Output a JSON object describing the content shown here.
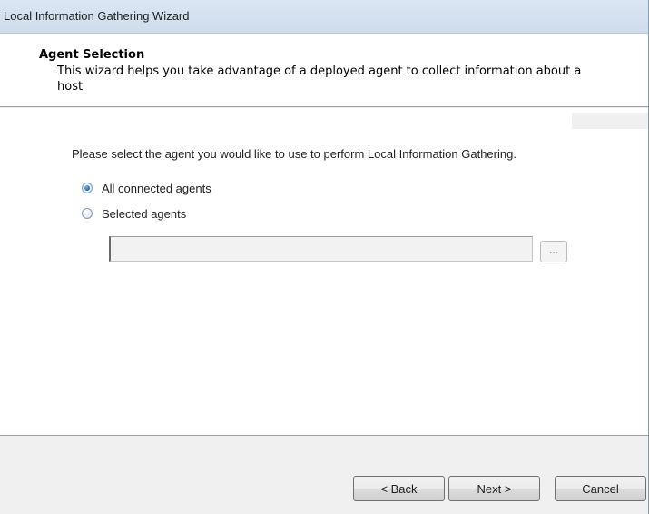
{
  "window": {
    "title": "Local Information Gathering Wizard"
  },
  "header": {
    "title": "Agent Selection",
    "description": "This wizard helps you take advantage of a deployed agent to collect information about a host"
  },
  "main": {
    "prompt": "Please select the agent you would like to use to perform Local Information Gathering.",
    "options": [
      {
        "label": "All connected agents",
        "checked": true
      },
      {
        "label": "Selected agents",
        "checked": false
      }
    ],
    "agent_field": {
      "value": "",
      "enabled": false
    },
    "browse_label": "..."
  },
  "footer": {
    "back_label": "< Back",
    "next_label": "Next >",
    "cancel_label": "Cancel"
  }
}
